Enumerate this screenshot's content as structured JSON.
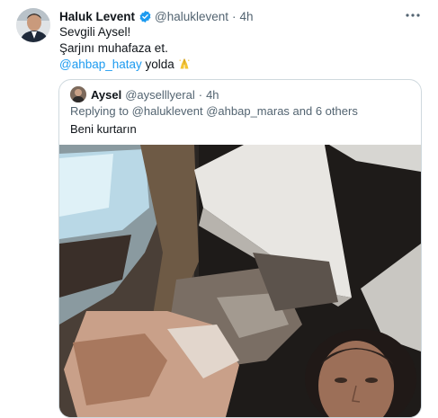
{
  "tweet": {
    "author_name": "Haluk Levent",
    "author_handle": "@haluklevent",
    "separator": "·",
    "time": "4h",
    "lines": [
      "Sevgili Aysel!",
      "Şarjını muhafaza et."
    ],
    "mention": "@ahbap_hatay",
    "mention_suffix": " yolda",
    "icons": {
      "verified": "verified-badge-icon",
      "more": "more-options-icon",
      "emoji": "folded-hands-emoji"
    },
    "colors": {
      "accent": "#1d9bf0",
      "secondary_text": "#536471",
      "border": "#cfd9de"
    }
  },
  "quote": {
    "author_name": "Aysel",
    "author_handle": "@ayselllyeral",
    "separator": "·",
    "time": "4h",
    "replying_prefix": "Replying to ",
    "replying_mentions": "@haluklevent @ahbap_maras and 6 others",
    "text": "Beni kurtarın"
  }
}
